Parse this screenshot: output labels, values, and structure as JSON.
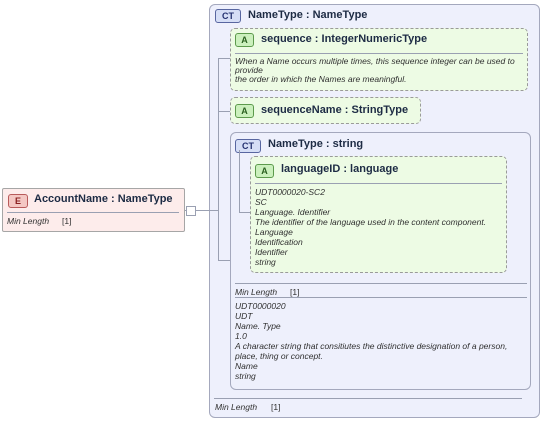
{
  "account_name": {
    "badge": "E",
    "title": "AccountName : NameType",
    "facet_label": "Min Length",
    "facet_value": "[1]"
  },
  "outer_type": {
    "badge": "CT",
    "title": "NameType : NameType",
    "facet_label": "Min Length",
    "facet_value": "[1]"
  },
  "sequence_attr": {
    "badge": "A",
    "title": "sequence : IntegerNumericType",
    "doc": [
      "When a Name occurs multiple times, this sequence integer can be used to provide",
      "the order in which the Names are meaningful."
    ]
  },
  "sequence_name_attr": {
    "badge": "A",
    "title": "sequenceName : StringType"
  },
  "inner_type": {
    "badge": "CT",
    "title": "NameType : string",
    "facet_label": "Min Length",
    "facet_value": "[1]",
    "doc": [
      "UDT0000020",
      "UDT",
      "Name. Type",
      "1.0",
      "A character string that consitiutes the distinctive designation of a person,",
      "place, thing or concept.",
      "Name",
      "string"
    ]
  },
  "language_attr": {
    "badge": "A",
    "title": "languageID : language",
    "doc": [
      "UDT0000020-SC2",
      "SC",
      "Language. Identifier",
      "The identifier of the language used in the content component.",
      "Language",
      "Identification",
      "Identifier",
      "string"
    ]
  }
}
